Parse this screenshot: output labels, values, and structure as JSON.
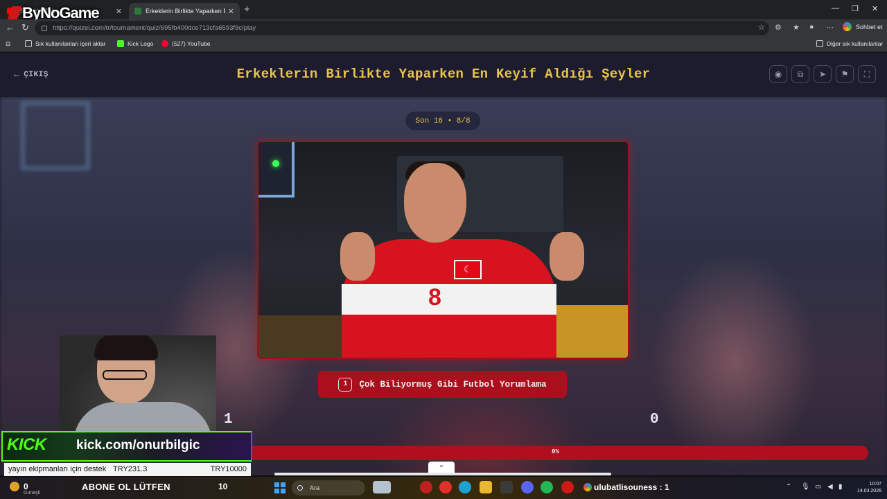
{
  "browser": {
    "overlay_logo": "ByNoGame",
    "tabs": [
      {
        "title": "(527) YouTube",
        "active": false
      },
      {
        "title": "Erkeklerin Birlikte Yaparken En Keyif",
        "active": true
      }
    ],
    "url": "https://quizei.com/tr/tournament/quiz/695fb400dce713cfa6593f9c/play",
    "sohbet_label": "Sohbet et",
    "bookmarks": [
      {
        "label": "Sık kullanılanları içeri aktar",
        "icon": "import-icon"
      },
      {
        "label": "Kick Logo",
        "icon": "kick-icon"
      },
      {
        "label": "(527) YouTube",
        "icon": "youtube-icon"
      }
    ],
    "other_bookmarks": "Diğer sık kullanılanlar"
  },
  "quiz": {
    "exit_label": "ÇIKIŞ",
    "title": "Erkeklerin Birlikte Yaparken En Keyif Aldığı Şeyler",
    "round_label": "Son 16 • 8/8",
    "choice_key": "1",
    "choice_label": "Çok Biliyormuş Gibi Futbol Yorumlama",
    "score_left": "1",
    "score_right": "0",
    "progress_text": "0%",
    "progress_fraction": 0.0,
    "jersey_number": "8",
    "header_icons": [
      "eye-icon",
      "share-icon",
      "send-icon",
      "flag-icon",
      "fullscreen-icon"
    ]
  },
  "stream": {
    "kick_logo": "KICK",
    "kick_url": "kick.com/onurbilgic",
    "donation_text": "yayın ekipmanları için destek",
    "donation_amount": "TRY231.3",
    "donation_goal": "TRY10000"
  },
  "taskbar": {
    "temp": "0",
    "weather_sub": "Güneşli",
    "abone": "ABONE OL LÜTFEN",
    "count": "10",
    "search_label": "Ara",
    "user_line": "ulubatlisouness : 1",
    "time": "10:07",
    "date": "14.03.2026"
  },
  "colors": {
    "title_gold": "#e9c44a",
    "choice_red": "#a90f1c",
    "kick_green": "#53fc18"
  }
}
